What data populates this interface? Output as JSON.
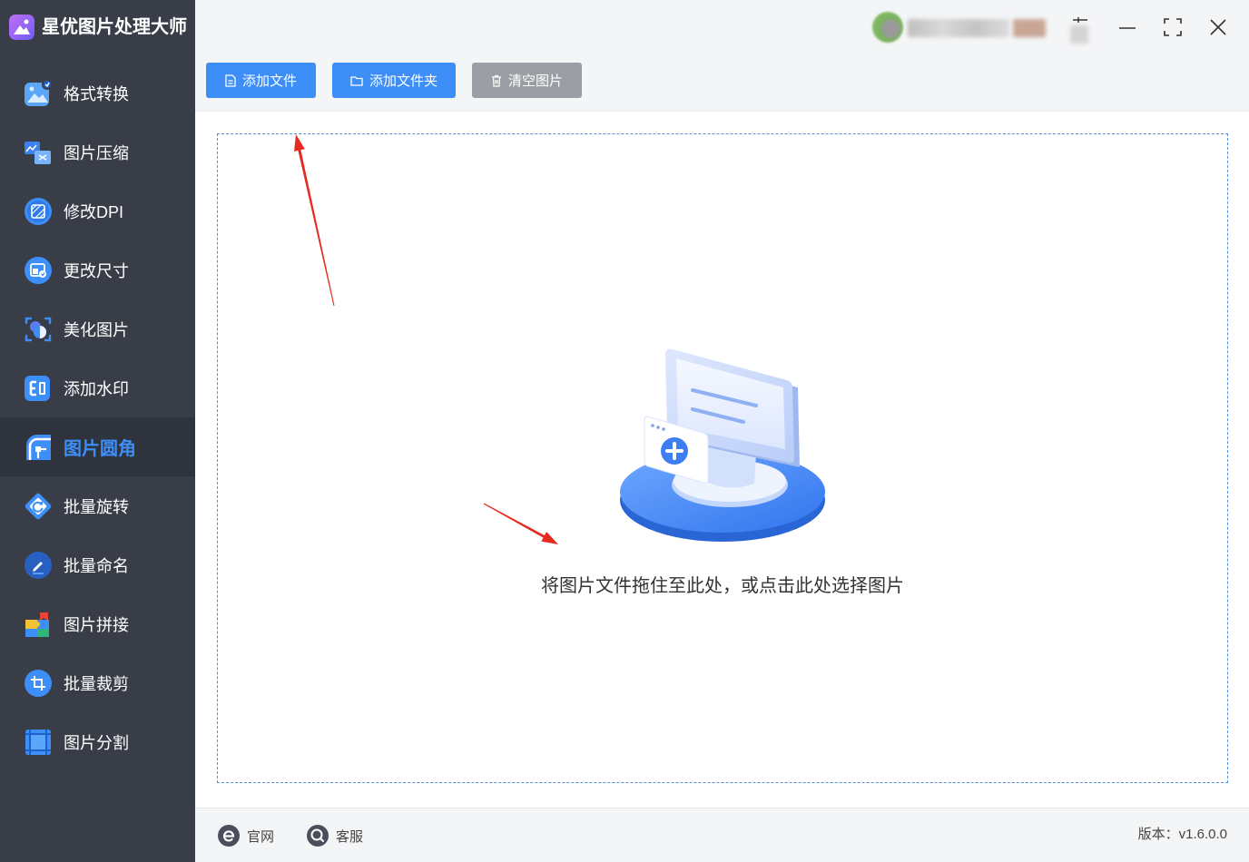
{
  "app": {
    "title": "星优图片处理大师",
    "logo_icon": "app-logo-icon"
  },
  "window_controls": {
    "icons": [
      "pin-icon",
      "minimize-icon",
      "maximize-icon",
      "close-icon"
    ]
  },
  "sidebar": {
    "items": [
      {
        "label": "格式转换",
        "icon": "format-convert-icon",
        "active": false
      },
      {
        "label": "图片压缩",
        "icon": "compress-icon",
        "active": false
      },
      {
        "label": "修改DPI",
        "icon": "dpi-icon",
        "active": false
      },
      {
        "label": "更改尺寸",
        "icon": "resize-icon",
        "active": false
      },
      {
        "label": "美化图片",
        "icon": "beautify-icon",
        "active": false
      },
      {
        "label": "添加水印",
        "icon": "watermark-icon",
        "active": false
      },
      {
        "label": "图片圆角",
        "icon": "rounded-corner-icon",
        "active": true
      },
      {
        "label": "批量旋转",
        "icon": "rotate-icon",
        "active": false
      },
      {
        "label": "批量命名",
        "icon": "rename-icon",
        "active": false
      },
      {
        "label": "图片拼接",
        "icon": "stitch-icon",
        "active": false
      },
      {
        "label": "批量裁剪",
        "icon": "crop-icon",
        "active": false
      },
      {
        "label": "图片分割",
        "icon": "split-icon",
        "active": false
      }
    ]
  },
  "toolbar": {
    "add_file": {
      "label": "添加文件",
      "icon": "file-icon"
    },
    "add_folder": {
      "label": "添加文件夹",
      "icon": "folder-icon"
    },
    "clear": {
      "label": "清空图片",
      "icon": "trash-icon"
    }
  },
  "dropzone": {
    "hint": "将图片文件拖住至此处，或点击此处选择图片",
    "illustration": "monitor-upload-illustration"
  },
  "footer": {
    "website": {
      "label": "官网",
      "icon": "website-icon"
    },
    "support": {
      "label": "客服",
      "icon": "support-icon"
    },
    "version": "版本：v1.6.0.0"
  },
  "colors": {
    "accent": "#3d8ef7",
    "sidebar_bg": "#393d48",
    "sidebar_active_bg": "#2f333d",
    "clear_button": "#9b9ea4",
    "annotation": "#e62a1f"
  }
}
